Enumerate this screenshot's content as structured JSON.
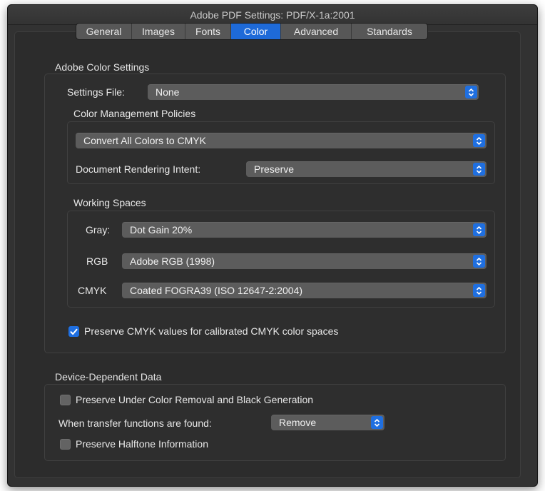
{
  "window": {
    "title": "Adobe PDF Settings: PDF/X-1a:2001"
  },
  "tabs": [
    {
      "label": "General"
    },
    {
      "label": "Images"
    },
    {
      "label": "Fonts"
    },
    {
      "label": "Color",
      "active": true
    },
    {
      "label": "Advanced"
    },
    {
      "label": "Standards"
    }
  ],
  "adobe_color_settings": {
    "heading": "Adobe Color Settings",
    "settings_file_label": "Settings File:",
    "settings_file_value": "None",
    "policies_heading": "Color Management Policies",
    "policy_value": "Convert All Colors to CMYK",
    "rendering_intent_label": "Document Rendering Intent:",
    "rendering_intent_value": "Preserve",
    "working_spaces_heading": "Working Spaces",
    "gray_label": "Gray:",
    "gray_value": "Dot Gain 20%",
    "rgb_label": "RGB",
    "rgb_value": "Adobe RGB (1998)",
    "cmyk_label": "CMYK",
    "cmyk_value": "Coated FOGRA39 (ISO 12647-2:2004)",
    "preserve_cmyk_label": "Preserve CMYK values for calibrated CMYK color spaces",
    "preserve_cmyk_checked": true
  },
  "device_dependent_data": {
    "heading": "Device-Dependent Data",
    "ucr_label": "Preserve Under Color Removal and Black Generation",
    "ucr_checked": false,
    "transfer_label": "When transfer functions are found:",
    "transfer_value": "Remove",
    "halftone_label": "Preserve Halftone Information",
    "halftone_checked": false
  },
  "colors": {
    "accent": "#1f6fe0",
    "window_bg": "#323232",
    "popup_bg": "#5c5c5c"
  },
  "icons": {
    "popup": "updown-chevron-icon",
    "check": "checkmark-icon"
  }
}
